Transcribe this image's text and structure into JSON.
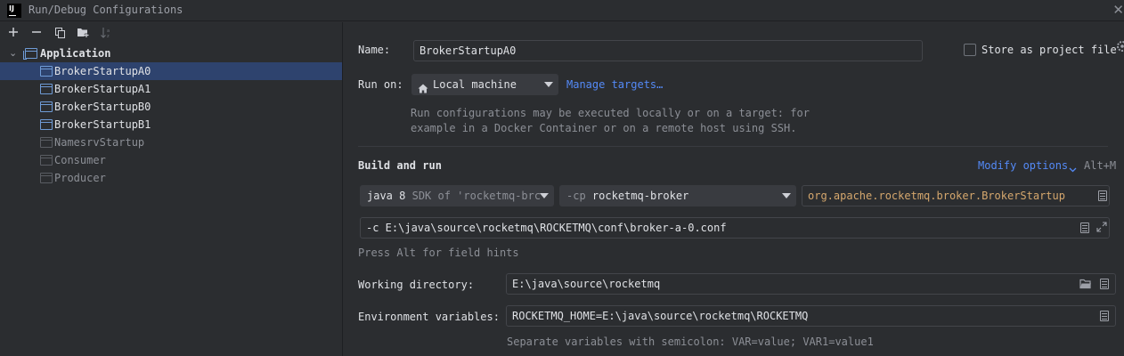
{
  "window": {
    "title": "Run/Debug Configurations",
    "logo_text": "IJ"
  },
  "toolbar": {
    "buttons": [
      {
        "icon": "plus-icon",
        "tooltip": "Add"
      },
      {
        "icon": "minus-icon",
        "tooltip": "Remove"
      },
      {
        "icon": "copy-icon",
        "tooltip": "Copy"
      },
      {
        "icon": "new-folder-icon",
        "tooltip": "Folder"
      },
      {
        "icon": "sort-icon",
        "tooltip": "Sort"
      }
    ]
  },
  "tree": {
    "group": "Application",
    "items": [
      {
        "label": "BrokerStartupA0",
        "selected": true,
        "active": true
      },
      {
        "label": "BrokerStartupA1",
        "active": true
      },
      {
        "label": "BrokerStartupB0",
        "active": true
      },
      {
        "label": "BrokerStartupB1",
        "active": true
      },
      {
        "label": "NamesrvStartup",
        "active": false
      },
      {
        "label": "Consumer",
        "active": false
      },
      {
        "label": "Producer",
        "active": false
      }
    ]
  },
  "form": {
    "name_label": "Name:",
    "name_value": "BrokerStartupA0",
    "store_label": "Store as project file",
    "run_on_label": "Run on:",
    "run_on_value": "Local machine",
    "manage_targets": "Manage targets…",
    "run_on_hint_1": "Run configurations may be executed locally or on a target: for",
    "run_on_hint_2": "example in a Docker Container or on a remote host using SSH.",
    "build_title": "Build and run",
    "modify_options": "Modify options",
    "modify_shortcut": "Alt+M",
    "jdk_main": "java 8",
    "jdk_sub": "SDK of 'rocketmq-brc",
    "cp_prefix": "-cp",
    "cp_value": "rocketmq-broker",
    "main_class": "org.apache.rocketmq.broker.BrokerStartup",
    "program_args": "-c E:\\java\\source\\rocketmq\\ROCKETMQ\\conf\\broker-a-0.conf",
    "field_hint": "Press Alt for field hints",
    "workdir_label": "Working directory:",
    "workdir_value": "E:\\java\\source\\rocketmq",
    "env_label": "Environment variables:",
    "env_value": "ROCKETMQ_HOME=E:\\java\\source\\rocketmq\\ROCKETMQ",
    "env_hint": "Separate variables with semicolon: VAR=value; VAR1=value1"
  },
  "colors": {
    "selection": "#2e436e",
    "link": "#548af7",
    "class_name": "#d5a76d",
    "background": "#2b2d30"
  }
}
